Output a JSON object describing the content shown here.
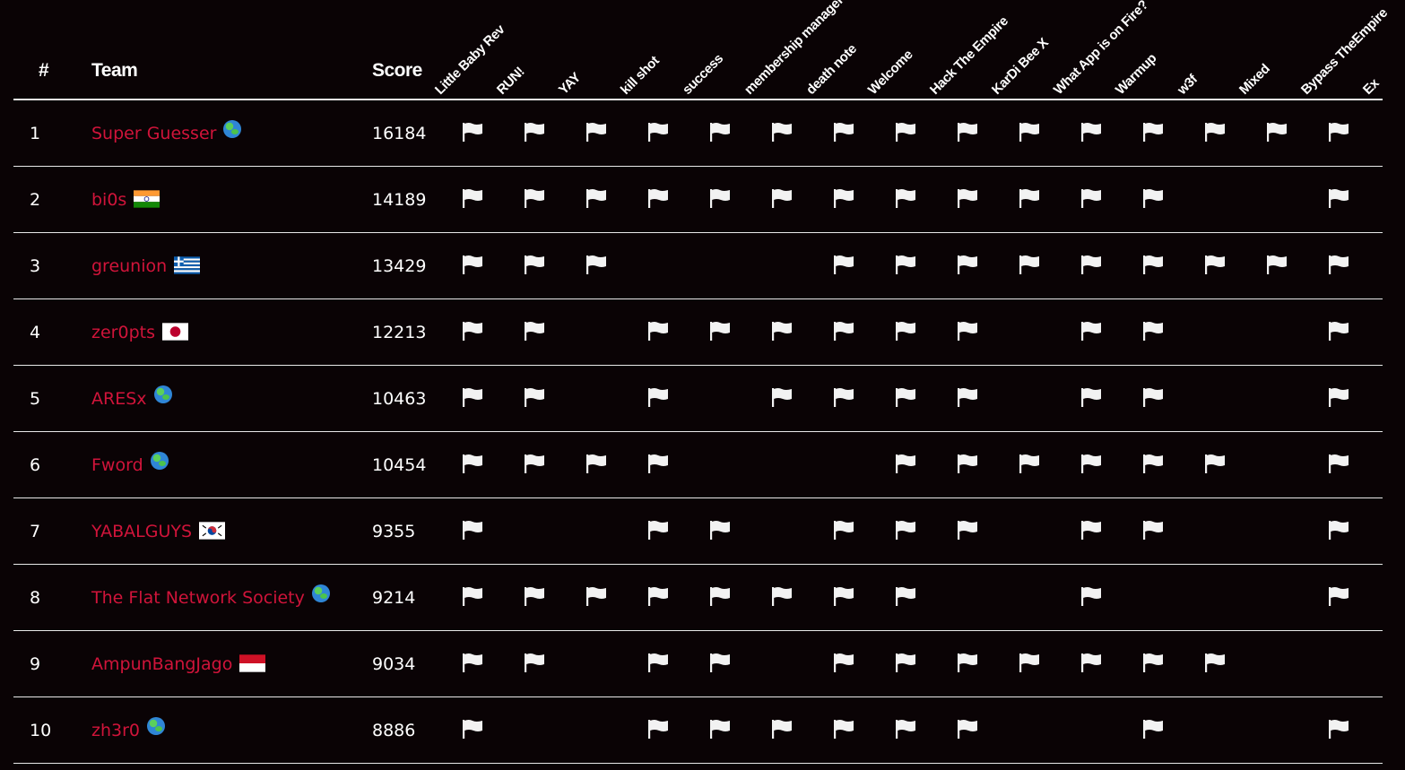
{
  "headers": {
    "rank": "#",
    "team": "Team",
    "score": "Score"
  },
  "challenges": [
    "Little Baby Rev",
    "RUN!",
    "YAY",
    "kill shot",
    "success",
    "membership manager",
    "death note",
    "Welcome",
    "Hack The Empire",
    "KarDi Bee X",
    "What App is on Fire?",
    "Warmup",
    "w3f",
    "Mixed",
    "Bypass TheEmpire",
    "Ex"
  ],
  "colors": {
    "background": "#0a0305",
    "team_name": "#d0143a",
    "text": "#ffffff",
    "flag_icon": "#f2f2f2"
  },
  "rows": [
    {
      "rank": "1",
      "team": "Super Guesser",
      "country": "globe",
      "score": "16184",
      "solves": [
        1,
        1,
        1,
        1,
        1,
        1,
        1,
        1,
        1,
        1,
        1,
        1,
        1,
        1,
        1
      ]
    },
    {
      "rank": "2",
      "team": "bi0s",
      "country": "india",
      "score": "14189",
      "solves": [
        1,
        1,
        1,
        1,
        1,
        1,
        1,
        1,
        1,
        1,
        1,
        1,
        0,
        0,
        1
      ]
    },
    {
      "rank": "3",
      "team": "greunion",
      "country": "greece",
      "score": "13429",
      "solves": [
        1,
        1,
        1,
        0,
        0,
        0,
        1,
        1,
        1,
        1,
        1,
        1,
        1,
        1,
        1
      ]
    },
    {
      "rank": "4",
      "team": "zer0pts",
      "country": "japan",
      "score": "12213",
      "solves": [
        1,
        1,
        0,
        1,
        1,
        1,
        1,
        1,
        1,
        0,
        1,
        1,
        0,
        0,
        1
      ]
    },
    {
      "rank": "5",
      "team": "ARESx",
      "country": "globe",
      "score": "10463",
      "solves": [
        1,
        1,
        0,
        1,
        0,
        1,
        1,
        1,
        1,
        0,
        1,
        1,
        0,
        0,
        1
      ]
    },
    {
      "rank": "6",
      "team": "Fword",
      "country": "globe",
      "score": "10454",
      "solves": [
        1,
        1,
        1,
        1,
        0,
        0,
        0,
        1,
        1,
        1,
        1,
        1,
        1,
        0,
        1
      ]
    },
    {
      "rank": "7",
      "team": "YABALGUYS",
      "country": "korea",
      "score": "9355",
      "solves": [
        1,
        0,
        0,
        1,
        1,
        0,
        1,
        1,
        1,
        0,
        1,
        1,
        0,
        0,
        1
      ]
    },
    {
      "rank": "8",
      "team": "The Flat Network Society",
      "country": "globe",
      "score": "9214",
      "solves": [
        1,
        1,
        1,
        1,
        1,
        1,
        1,
        1,
        0,
        0,
        1,
        0,
        0,
        0,
        1
      ]
    },
    {
      "rank": "9",
      "team": "AmpunBangJago",
      "country": "indonesia",
      "score": "9034",
      "solves": [
        1,
        1,
        0,
        1,
        1,
        0,
        1,
        1,
        1,
        1,
        1,
        1,
        1,
        0,
        0
      ]
    },
    {
      "rank": "10",
      "team": "zh3r0",
      "country": "globe",
      "score": "8886",
      "solves": [
        1,
        0,
        0,
        1,
        1,
        1,
        1,
        1,
        1,
        0,
        0,
        1,
        0,
        0,
        1
      ]
    }
  ]
}
